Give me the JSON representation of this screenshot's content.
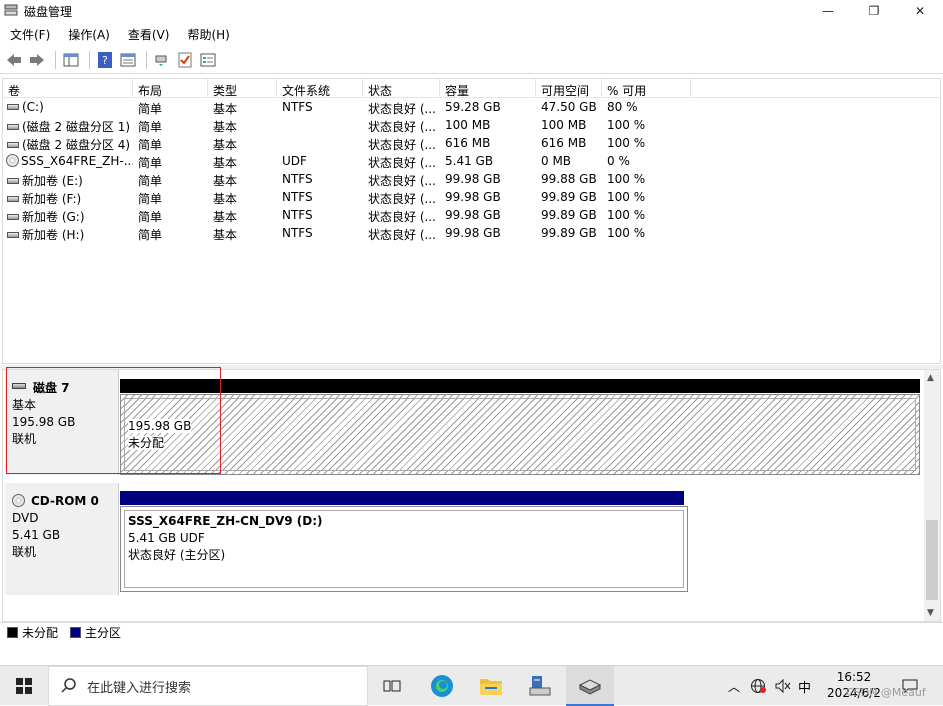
{
  "window": {
    "title": "磁盘管理",
    "min": "—",
    "max": "❐",
    "close": "✕"
  },
  "menu": [
    "文件(F)",
    "操作(A)",
    "查看(V)",
    "帮助(H)"
  ],
  "columns": [
    "卷",
    "布局",
    "类型",
    "文件系统",
    "状态",
    "容量",
    "可用空间",
    "% 可用"
  ],
  "volumes": [
    {
      "name": "(C:)",
      "layout": "简单",
      "type": "基本",
      "fs": "NTFS",
      "status": "状态良好 (...",
      "capacity": "59.28 GB",
      "free": "47.50 GB",
      "pct": "80 %",
      "icon": "drive-icon"
    },
    {
      "name": "(磁盘 2 磁盘分区 1)",
      "layout": "简单",
      "type": "基本",
      "fs": "",
      "status": "状态良好 (...",
      "capacity": "100 MB",
      "free": "100 MB",
      "pct": "100 %",
      "icon": "drive-icon"
    },
    {
      "name": "(磁盘 2 磁盘分区 4)",
      "layout": "简单",
      "type": "基本",
      "fs": "",
      "status": "状态良好 (...",
      "capacity": "616 MB",
      "free": "616 MB",
      "pct": "100 %",
      "icon": "drive-icon"
    },
    {
      "name": "SSS_X64FRE_ZH-...",
      "layout": "简单",
      "type": "基本",
      "fs": "UDF",
      "status": "状态良好 (...",
      "capacity": "5.41 GB",
      "free": "0 MB",
      "pct": "0 %",
      "icon": "cd-icon"
    },
    {
      "name": "新加卷 (E:)",
      "layout": "简单",
      "type": "基本",
      "fs": "NTFS",
      "status": "状态良好 (...",
      "capacity": "99.98 GB",
      "free": "99.88 GB",
      "pct": "100 %",
      "icon": "drive-icon"
    },
    {
      "name": "新加卷 (F:)",
      "layout": "简单",
      "type": "基本",
      "fs": "NTFS",
      "status": "状态良好 (...",
      "capacity": "99.98 GB",
      "free": "99.89 GB",
      "pct": "100 %",
      "icon": "drive-icon"
    },
    {
      "name": "新加卷 (G:)",
      "layout": "简单",
      "type": "基本",
      "fs": "NTFS",
      "status": "状态良好 (...",
      "capacity": "99.98 GB",
      "free": "99.89 GB",
      "pct": "100 %",
      "icon": "drive-icon"
    },
    {
      "name": "新加卷 (H:)",
      "layout": "简单",
      "type": "基本",
      "fs": "NTFS",
      "status": "状态良好 (...",
      "capacity": "99.98 GB",
      "free": "99.89 GB",
      "pct": "100 %",
      "icon": "drive-icon"
    }
  ],
  "disks": [
    {
      "name": "磁盘 7",
      "type": "基本",
      "size": "195.98 GB",
      "state": "联机",
      "partition": {
        "size": "195.98 GB",
        "label": "未分配"
      }
    },
    {
      "name": "CD-ROM 0",
      "type": "DVD",
      "size": "5.41 GB",
      "state": "联机",
      "partition": {
        "name": "SSS_X64FRE_ZH-CN_DV9  (D:)",
        "size": "5.41 GB UDF",
        "label": "状态良好 (主分区)"
      }
    }
  ],
  "legend": [
    {
      "label": "未分配",
      "color": "#000000"
    },
    {
      "label": "主分区",
      "color": "#000080"
    }
  ],
  "taskbar": {
    "search_placeholder": "在此键入进行搜索",
    "ime": "中",
    "time": "16:52",
    "date": "2024/6/2",
    "watermark": "CSDN @Meauf"
  },
  "colors": {
    "unallocated": "#000000",
    "primary": "#000080",
    "selection": "#e02020"
  }
}
